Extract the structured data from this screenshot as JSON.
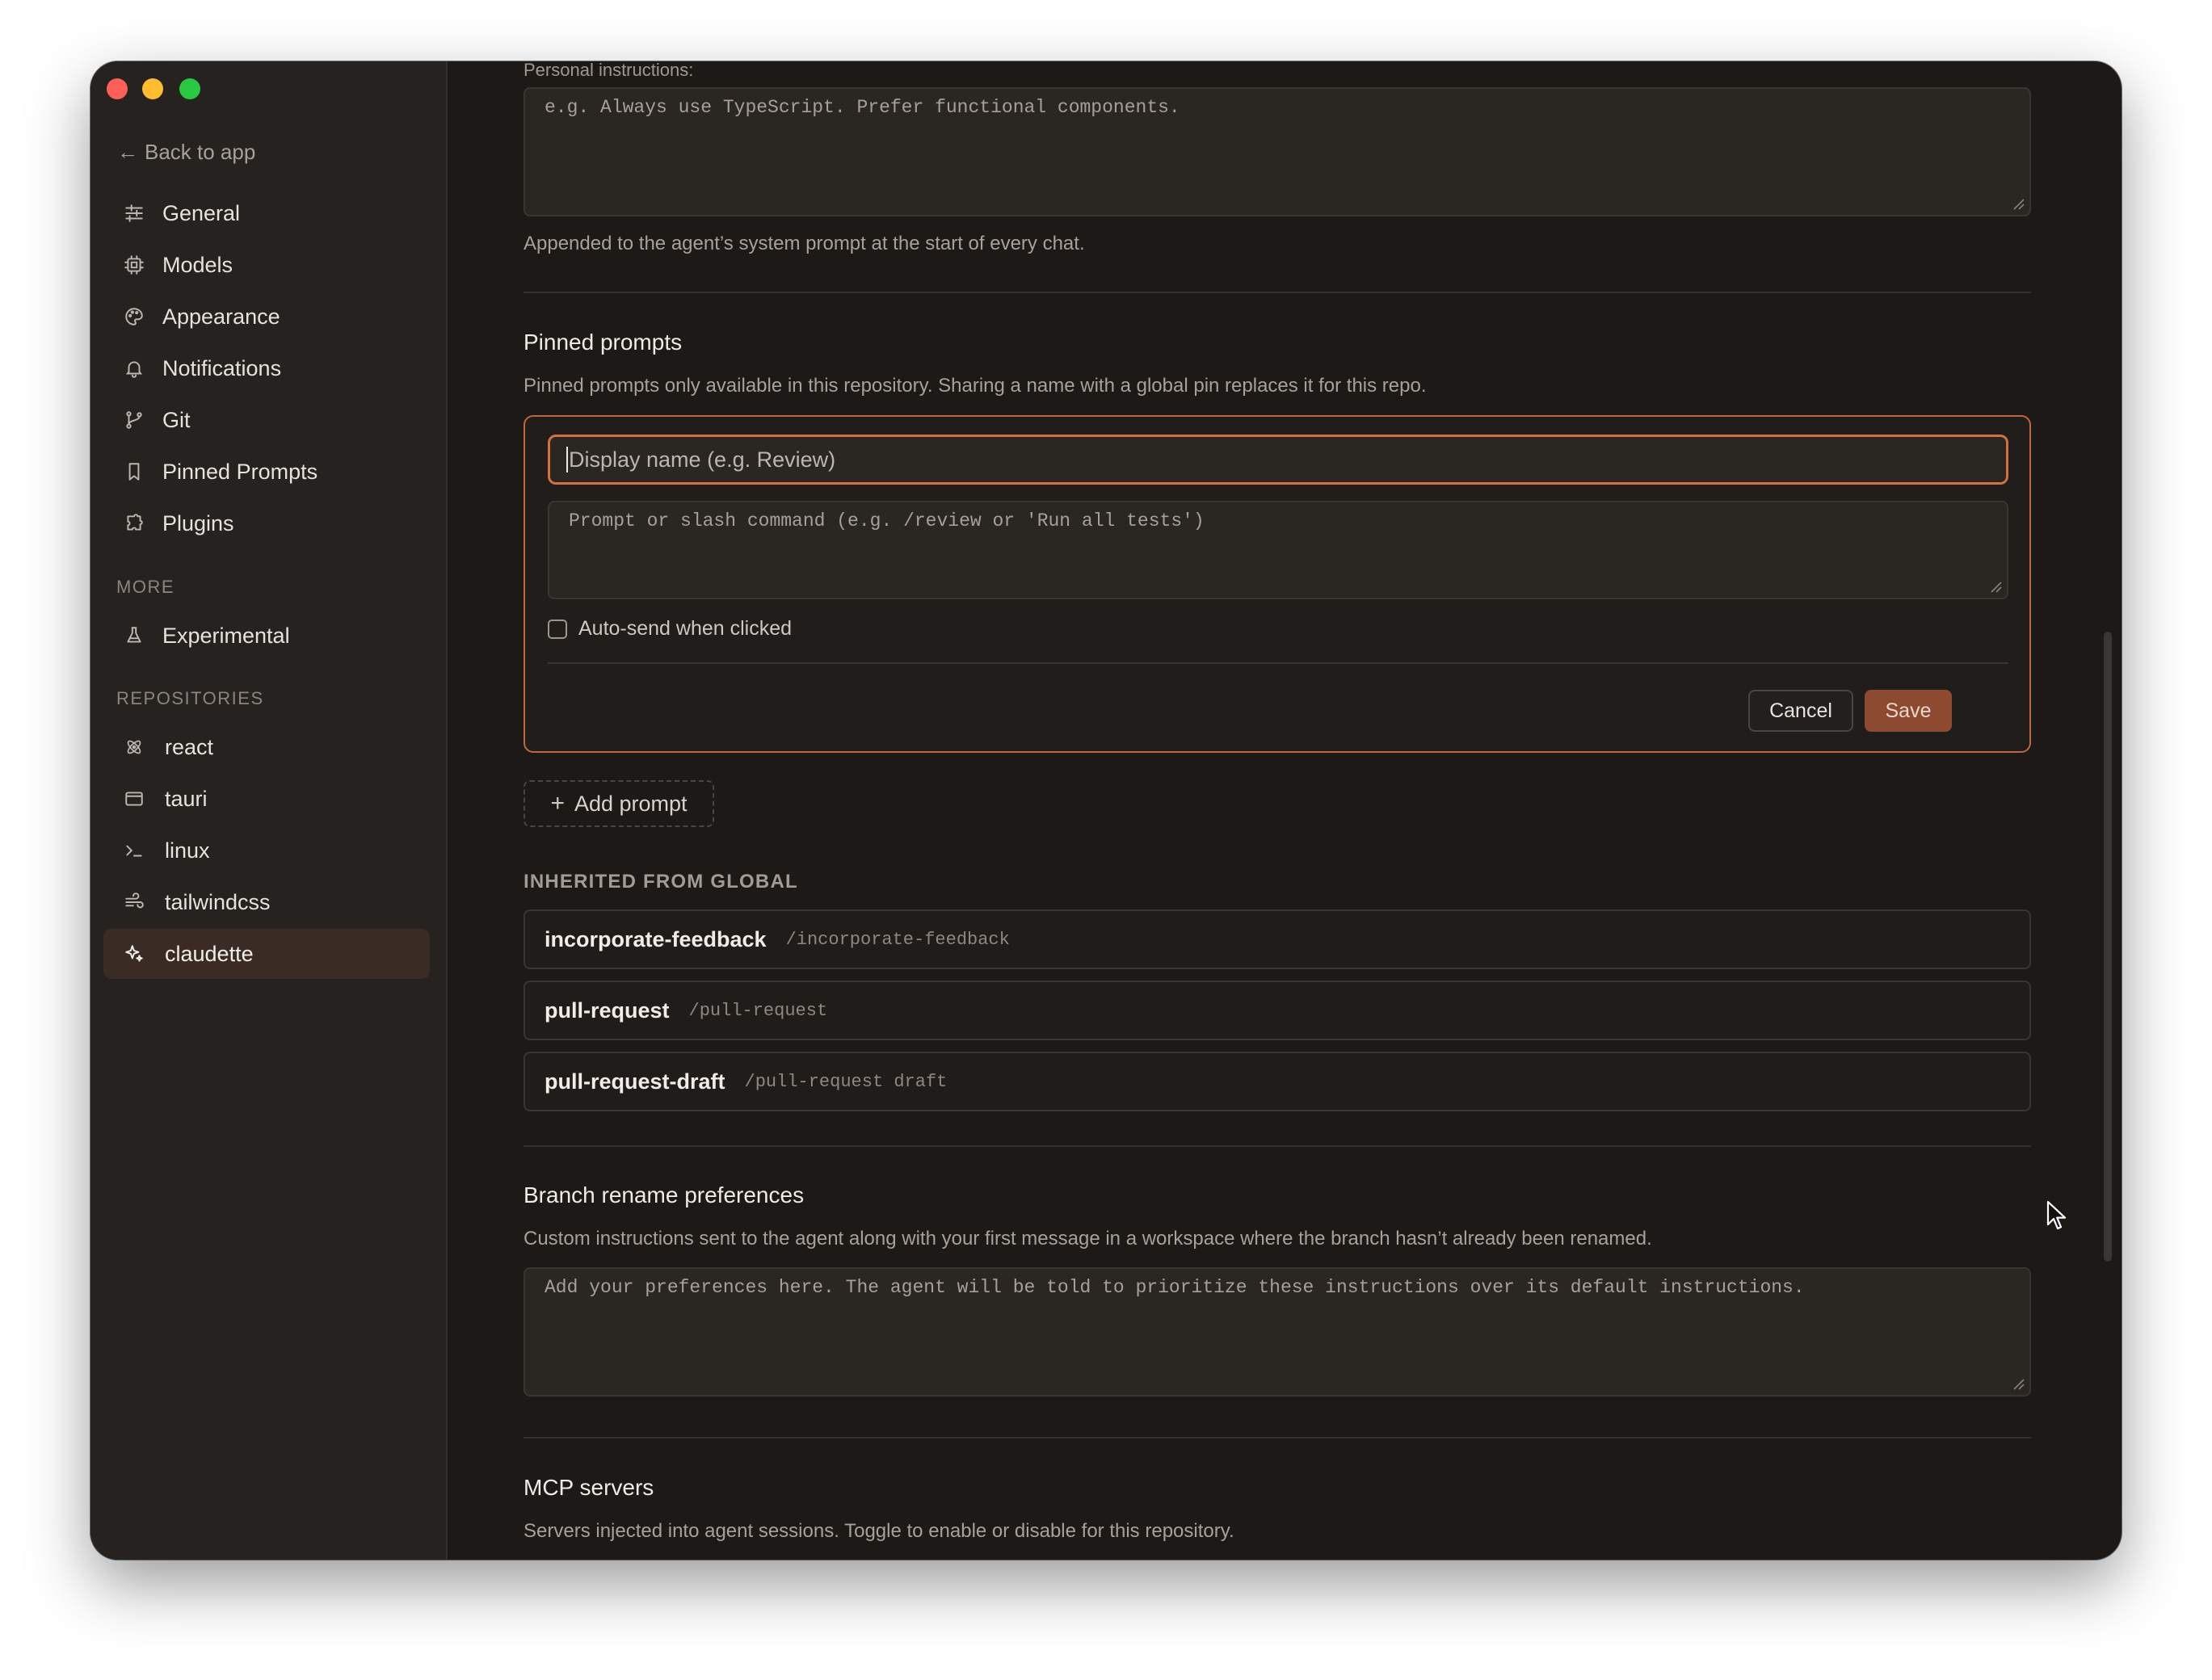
{
  "window": {
    "controls": [
      "close",
      "minimize",
      "zoom"
    ]
  },
  "sidebar": {
    "back_label": "Back to app",
    "items": [
      {
        "label": "General",
        "icon": "sliders-icon"
      },
      {
        "label": "Models",
        "icon": "cpu-icon"
      },
      {
        "label": "Appearance",
        "icon": "palette-icon"
      },
      {
        "label": "Notifications",
        "icon": "bell-icon"
      },
      {
        "label": "Git",
        "icon": "git-branch-icon"
      },
      {
        "label": "Pinned Prompts",
        "icon": "bookmark-icon"
      },
      {
        "label": "Plugins",
        "icon": "puzzle-icon"
      }
    ],
    "more_label": "MORE",
    "more_items": [
      {
        "label": "Experimental",
        "icon": "flask-icon"
      }
    ],
    "repos_label": "REPOSITORIES",
    "repos": [
      {
        "label": "react",
        "icon": "atom-icon"
      },
      {
        "label": "tauri",
        "icon": "window-icon"
      },
      {
        "label": "linux",
        "icon": "terminal-icon"
      },
      {
        "label": "tailwindcss",
        "icon": "wind-icon"
      },
      {
        "label": "claudette",
        "icon": "sparkles-icon",
        "active": true
      }
    ]
  },
  "main": {
    "personal": {
      "label": "Personal instructions:",
      "placeholder": "e.g. Always use TypeScript. Prefer functional components.",
      "help": "Appended to the agent’s system prompt at the start of every chat."
    },
    "pinned": {
      "title": "Pinned prompts",
      "description": "Pinned prompts only available in this repository. Sharing a name with a global pin replaces it for this repo.",
      "name_placeholder": "Display name (e.g. Review)",
      "prompt_placeholder": "Prompt or slash command (e.g. /review or 'Run all tests')",
      "auto_send_label": "Auto-send when clicked",
      "cancel_label": "Cancel",
      "save_label": "Save",
      "add_label": "Add prompt",
      "inherited_label": "INHERITED FROM GLOBAL",
      "inherited": [
        {
          "name": "incorporate-feedback",
          "command": "/incorporate-feedback"
        },
        {
          "name": "pull-request",
          "command": "/pull-request"
        },
        {
          "name": "pull-request-draft",
          "command": "/pull-request draft"
        }
      ]
    },
    "branch": {
      "title": "Branch rename preferences",
      "description": "Custom instructions sent to the agent along with your first message in a workspace where the branch hasn’t already been renamed.",
      "placeholder": "Add your preferences here. The agent will be told to prioritize these instructions over its default instructions."
    },
    "mcp": {
      "title": "MCP servers",
      "description": "Servers injected into agent sessions. Toggle to enable or disable for this repository."
    }
  },
  "colors": {
    "accent": "#c0673f",
    "save_bg": "#8e4a31",
    "active_item_bg": "#3a2b25",
    "window_bg": "#1c1917",
    "sidebar_bg": "#252220"
  }
}
